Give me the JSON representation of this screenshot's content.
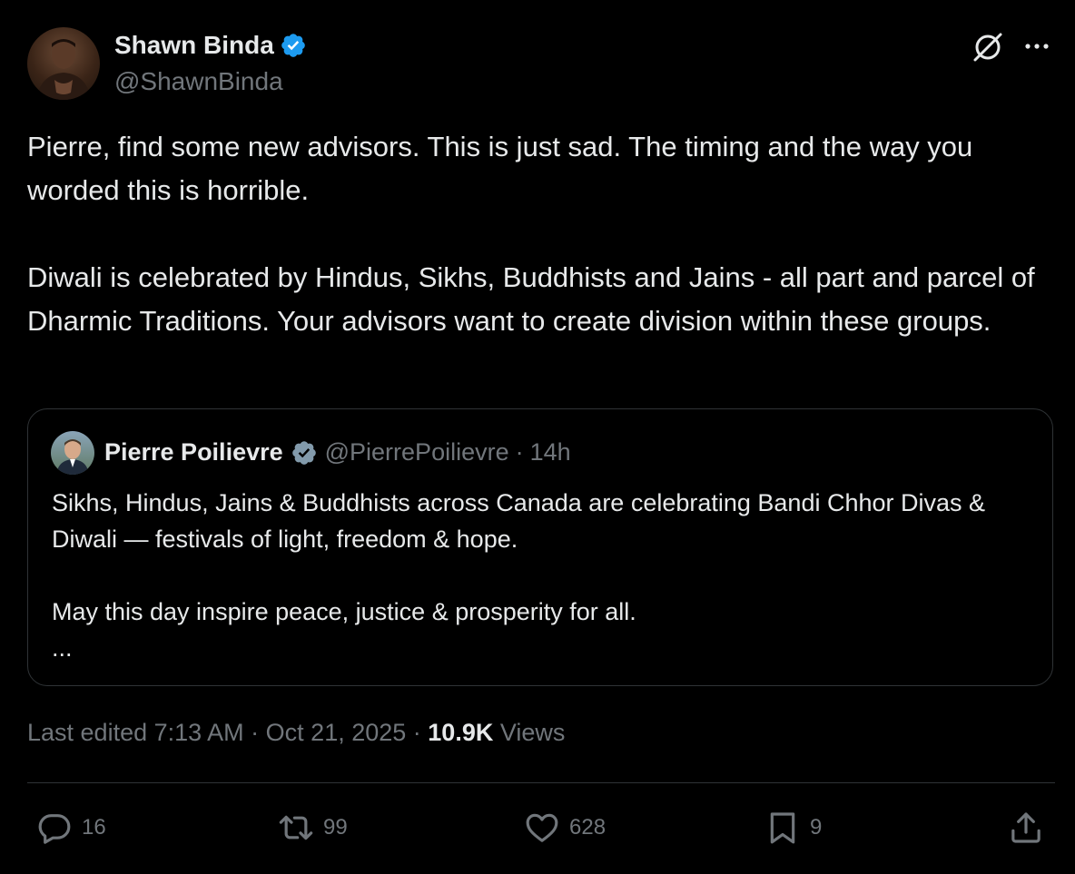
{
  "author": {
    "name": "Shawn Binda",
    "handle": "@ShawnBinda",
    "verified": true
  },
  "tweet": {
    "paragraphs": [
      "Pierre, find some new advisors. This is just sad. The timing and the way you worded this is horrible.",
      "Diwali is celebrated by Hindus, Sikhs, Buddhists and Jains - all part and parcel of Dharmic Traditions. Your advisors want to create division within these groups."
    ]
  },
  "quote": {
    "name": "Pierre Poilievre",
    "handle": "@PierrePoilievre",
    "separator": "·",
    "time": "14h",
    "paragraphs": [
      "Sikhs, Hindus, Jains & Buddhists across Canada are celebrating Bandi Chhor Divas & Diwali — festivals of light, freedom & hope.",
      "May this day inspire peace, justice & prosperity for all.",
      "..."
    ]
  },
  "meta": {
    "edited": "Last edited 7:13 AM",
    "separator1": " · ",
    "date": "Oct 21, 2025",
    "separator2": " · ",
    "views_count": "10.9K",
    "views_label": " Views"
  },
  "actions": {
    "replies": "16",
    "reposts": "99",
    "likes": "628",
    "bookmarks": "9"
  },
  "colors": {
    "background": "#000000",
    "text": "#e7e9ea",
    "muted": "#71767b",
    "border": "#2f3336",
    "verified_blue": "#1d9bf0",
    "verified_grey": "#829aab"
  },
  "icons": {
    "verified": "verified-badge-icon",
    "grok": "grok-icon",
    "more": "more-dots-icon",
    "reply": "reply-icon",
    "repost": "repost-icon",
    "like": "heart-icon",
    "bookmark": "bookmark-icon",
    "share": "share-icon"
  }
}
